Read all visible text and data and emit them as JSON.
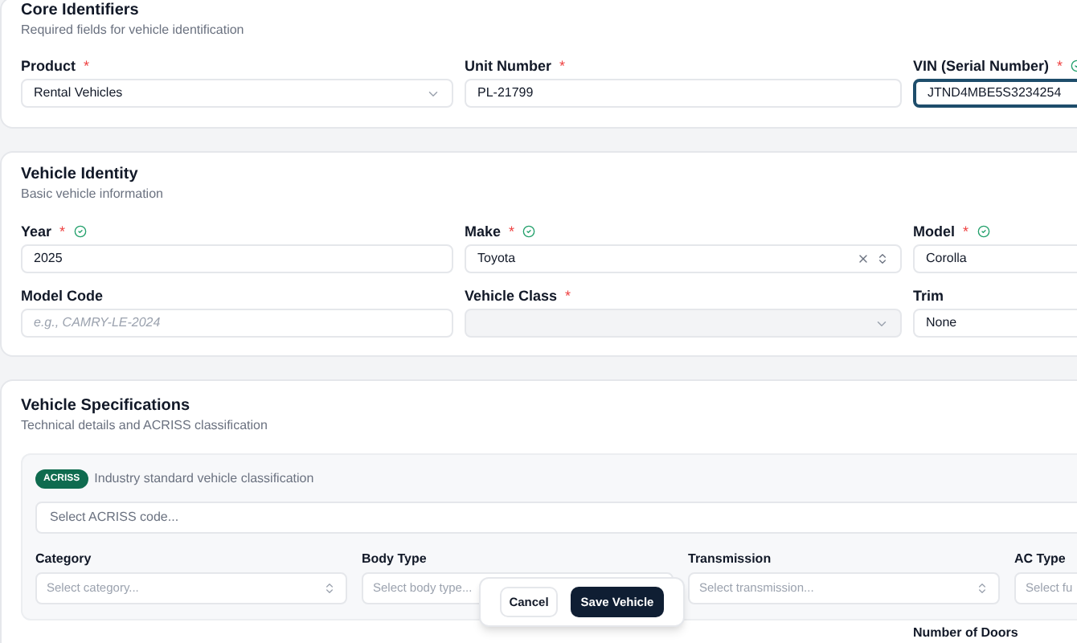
{
  "required_mark": "*",
  "sections": [
    {
      "title": "Core Identifiers",
      "subtitle": "Required fields for vehicle identification",
      "fields": [
        {
          "label": "Product",
          "required": true,
          "verified": false,
          "kind": "select",
          "value": "Rental Vehicles",
          "focused": false
        },
        {
          "label": "Unit Number",
          "required": true,
          "verified": false,
          "kind": "input",
          "value": "PL-21799",
          "focused": false
        },
        {
          "label": "VIN (Serial Number)",
          "required": true,
          "verified": true,
          "kind": "input",
          "value": "JTND4MBE5S3234254",
          "focused": true
        }
      ]
    },
    {
      "title": "Vehicle Identity",
      "subtitle": "Basic vehicle information",
      "fields": [
        {
          "label": "Year",
          "required": true,
          "verified": true,
          "kind": "input",
          "value": "2025",
          "focused": false
        },
        {
          "label": "Make",
          "required": true,
          "verified": true,
          "kind": "combobox",
          "value": "Toyota",
          "focused": false
        },
        {
          "label": "Model",
          "required": true,
          "verified": true,
          "kind": "input",
          "value": "Corolla",
          "focused": false
        },
        {
          "label": "Model Code",
          "required": false,
          "verified": false,
          "kind": "input",
          "placeholder": "e.g., CAMRY-LE-2024",
          "focused": false
        },
        {
          "label": "Vehicle Class",
          "required": true,
          "verified": false,
          "kind": "select",
          "disabled": true,
          "focused": false
        },
        {
          "label": "Trim",
          "required": false,
          "verified": false,
          "kind": "input",
          "value": "None",
          "focused": false
        }
      ]
    }
  ],
  "specifications": {
    "title": "Vehicle Specifications",
    "subtitle": "Technical details and ACRISS classification",
    "acriss": {
      "badge": "ACRISS",
      "description": "Industry standard vehicle classification",
      "placeholder": "Select ACRISS code..."
    },
    "fields": [
      {
        "label": "Category",
        "placeholder": "Select category..."
      },
      {
        "label": "Body Type",
        "placeholder": "Select body type..."
      },
      {
        "label": "Transmission",
        "placeholder": "Select transmission..."
      },
      {
        "label": "AC Type",
        "placeholder": "Select fu"
      }
    ],
    "next_label": "Number of Doors"
  },
  "actions": [
    {
      "label": "Cancel",
      "kind": "secondary"
    },
    {
      "label": "Save Vehicle",
      "kind": "primary"
    }
  ]
}
